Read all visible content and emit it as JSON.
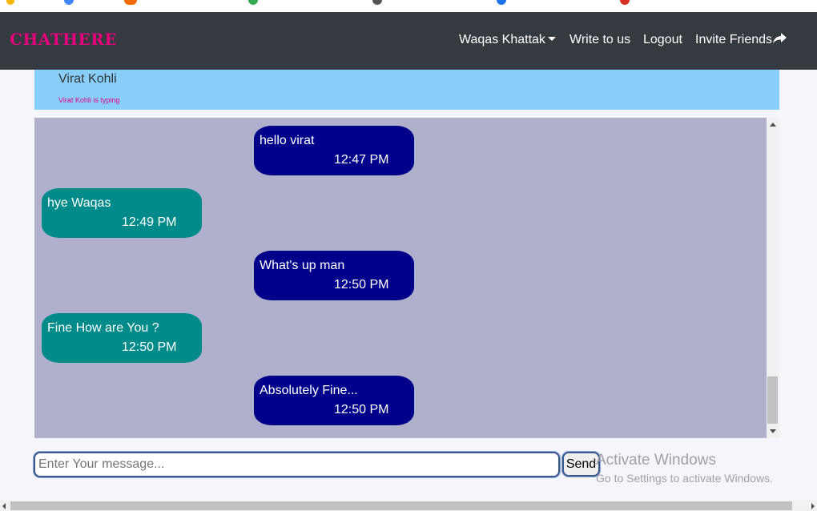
{
  "navbar": {
    "brand": "CHATHERE",
    "user_menu": "Waqas Khattak",
    "write_to_us": "Write to us",
    "logout": "Logout",
    "invite_friends": "Invite Friends"
  },
  "chat": {
    "contact_name": "Virat Kohli",
    "typing_status": "Virat Kohli is typing",
    "messages": [
      {
        "direction": "sent",
        "text": "hello virat",
        "time": "12:47 PM"
      },
      {
        "direction": "received",
        "text": "hye Waqas",
        "time": "12:49 PM"
      },
      {
        "direction": "sent",
        "text": "What's up man",
        "time": "12:50 PM"
      },
      {
        "direction": "received",
        "text": "Fine How are You ?",
        "time": "12:50 PM"
      },
      {
        "direction": "sent",
        "text": "Absolutely Fine...",
        "time": "12:50 PM"
      }
    ]
  },
  "composer": {
    "placeholder": "Enter Your message...",
    "send_label": "Send"
  },
  "watermark": {
    "title": "Activate Windows",
    "subtitle": "Go to Settings to activate Windows."
  },
  "colors": {
    "navbar_bg": "#343a40",
    "brand": "#e6007e",
    "header_bg": "#87cefa",
    "messages_bg": "#b0b0cc",
    "sent_bubble": "#00008b",
    "received_bubble": "#008b8b"
  }
}
